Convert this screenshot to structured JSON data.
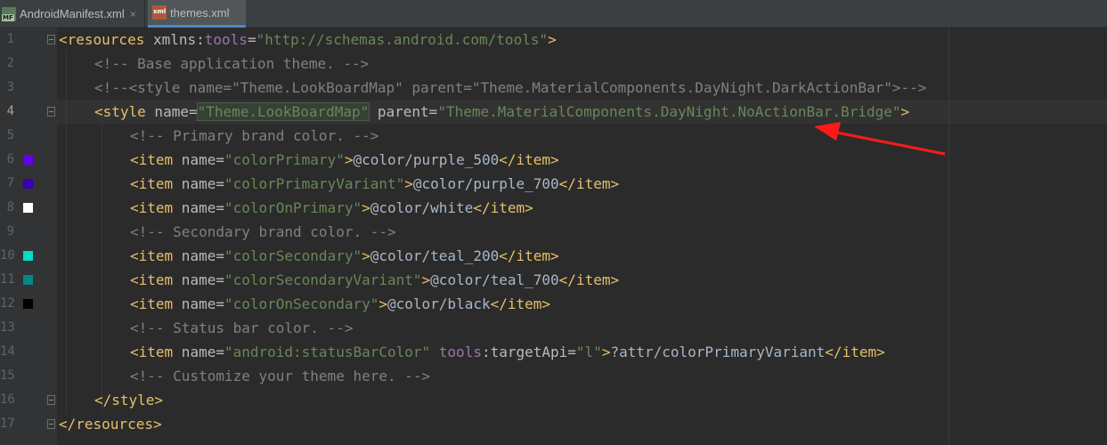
{
  "tabs": [
    {
      "label": "AndroidManifest.xml",
      "icon": "MF"
    },
    {
      "label": "themes.xml",
      "icon": "xml"
    }
  ],
  "tab_close_glyph": "×",
  "line_numbers": [
    "1",
    "2",
    "3",
    "4",
    "5",
    "6",
    "7",
    "8",
    "9",
    "10",
    "11",
    "12",
    "13",
    "14",
    "15",
    "16",
    "17"
  ],
  "swatches": {
    "line6": "#6200EE",
    "line7": "#3700B3",
    "line8": "#FFFFFF",
    "line10": "#03DAC5",
    "line11": "#018786",
    "line12": "#000000"
  },
  "code": {
    "l1": {
      "open": "<resources",
      "attr": " xmlns:",
      "ns": "tools",
      "eq": "=",
      "val": "\"http://schemas.android.com/tools\"",
      "close": ">"
    },
    "l2": {
      "comment": "<!-- Base application theme. -->"
    },
    "l3": {
      "comment": "<!--<style name=\"Theme.LookBoardMap\" parent=\"Theme.MaterialComponents.DayNight.DarkActionBar\">-->"
    },
    "l4": {
      "open": "<style",
      "attr1": " name=",
      "val1": "\"Theme.LookBoardMap\"",
      "attr2": " parent=",
      "val2": "\"Theme.MaterialComponents.DayNight.NoActionBar.Bridge\"",
      "close": ">"
    },
    "l5": {
      "comment": "<!-- Primary brand color. -->"
    },
    "l6": {
      "open": "<item",
      "attr": " name=",
      "val": "\"colorPrimary\"",
      "gt": ">",
      "text": "@color/purple_500",
      "close": "</item>"
    },
    "l7": {
      "open": "<item",
      "attr": " name=",
      "val": "\"colorPrimaryVariant\"",
      "gt": ">",
      "text": "@color/purple_700",
      "close": "</item>"
    },
    "l8": {
      "open": "<item",
      "attr": " name=",
      "val": "\"colorOnPrimary\"",
      "gt": ">",
      "text": "@color/white",
      "close": "</item>"
    },
    "l9": {
      "comment": "<!-- Secondary brand color. -->"
    },
    "l10": {
      "open": "<item",
      "attr": " name=",
      "val": "\"colorSecondary\"",
      "gt": ">",
      "text": "@color/teal_200",
      "close": "</item>"
    },
    "l11": {
      "open": "<item",
      "attr": " name=",
      "val": "\"colorSecondaryVariant\"",
      "gt": ">",
      "text": "@color/teal_700",
      "close": "</item>"
    },
    "l12": {
      "open": "<item",
      "attr": " name=",
      "val": "\"colorOnSecondary\"",
      "gt": ">",
      "text": "@color/black",
      "close": "</item>"
    },
    "l13": {
      "comment": "<!-- Status bar color. -->"
    },
    "l14": {
      "open": "<item",
      "attr": " name=",
      "val": "\"android:statusBarColor\"",
      "ns": " tools",
      "attr2": ":targetApi=",
      "val2": "\"l\"",
      "gt": ">",
      "text": "?attr/colorPrimaryVariant",
      "close": "</item>"
    },
    "l15": {
      "comment": "<!-- Customize your theme here. -->"
    },
    "l16": {
      "close": "</style>"
    },
    "l17": {
      "close": "</resources>"
    }
  }
}
